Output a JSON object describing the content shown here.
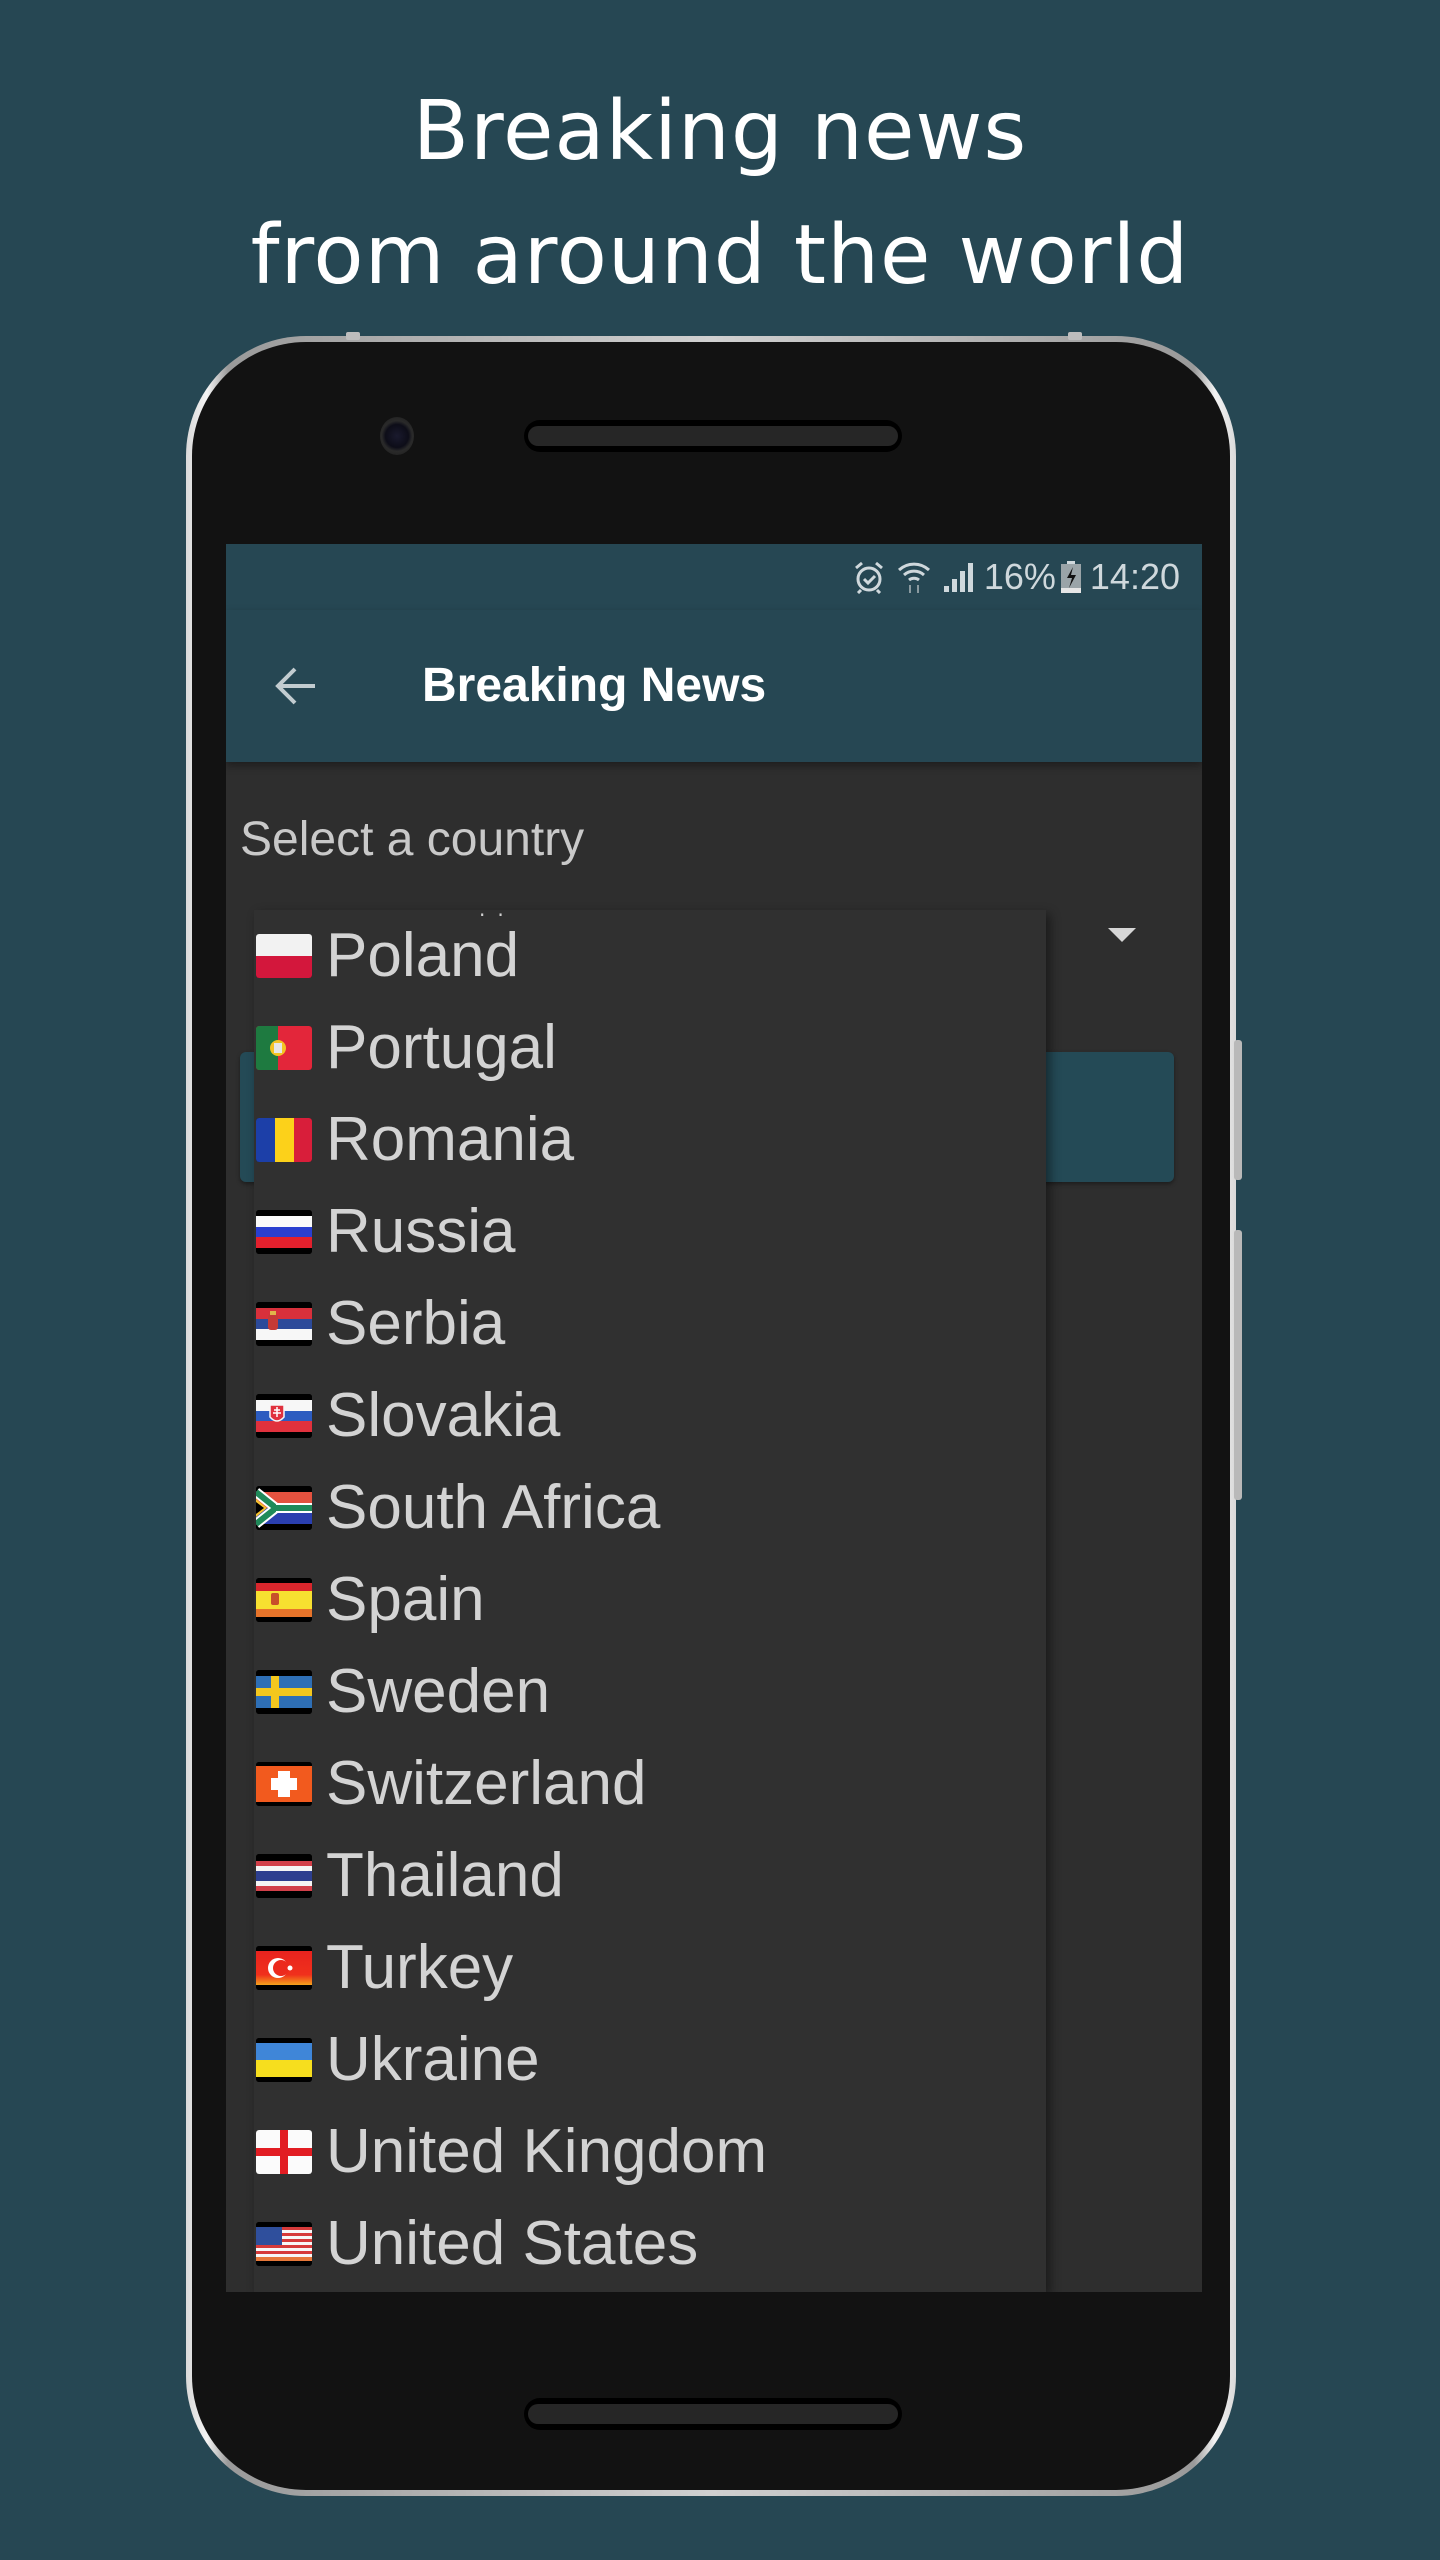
{
  "promo": {
    "line1": "Breaking news",
    "line2": "from around the world"
  },
  "status_bar": {
    "icons": [
      "alarm-icon",
      "wifi-icon",
      "signal-icon",
      "battery-charging-icon"
    ],
    "battery_percent": "16%",
    "time": "14:20"
  },
  "app_bar": {
    "back_icon": "arrow-left-icon",
    "title": "Breaking News"
  },
  "form": {
    "select_label": "Select a country",
    "spinner_icon": "dropdown-arrow-icon"
  },
  "dropdown": {
    "items": [
      {
        "label": "Poland",
        "flag": "flag-poland-icon"
      },
      {
        "label": "Portugal",
        "flag": "flag-portugal-icon"
      },
      {
        "label": "Romania",
        "flag": "flag-romania-icon"
      },
      {
        "label": "Russia",
        "flag": "flag-russia-icon"
      },
      {
        "label": "Serbia",
        "flag": "flag-serbia-icon"
      },
      {
        "label": "Slovakia",
        "flag": "flag-slovakia-icon"
      },
      {
        "label": "South Africa",
        "flag": "flag-south-africa-icon"
      },
      {
        "label": "Spain",
        "flag": "flag-spain-icon"
      },
      {
        "label": "Sweden",
        "flag": "flag-sweden-icon"
      },
      {
        "label": "Switzerland",
        "flag": "flag-switzerland-icon"
      },
      {
        "label": "Thailand",
        "flag": "flag-thailand-icon"
      },
      {
        "label": "Turkey",
        "flag": "flag-turkey-icon"
      },
      {
        "label": "Ukraine",
        "flag": "flag-ukraine-icon"
      },
      {
        "label": "United Kingdom",
        "flag": "flag-england-icon"
      },
      {
        "label": "United States",
        "flag": "flag-united-states-icon"
      }
    ]
  },
  "colors": {
    "background": "#264753",
    "app_bar": "#264753",
    "screen_bg": "#2e2e2e",
    "dropdown_bg": "#303030",
    "text_light": "#d3d3d3",
    "title_text": "#ffffff"
  }
}
